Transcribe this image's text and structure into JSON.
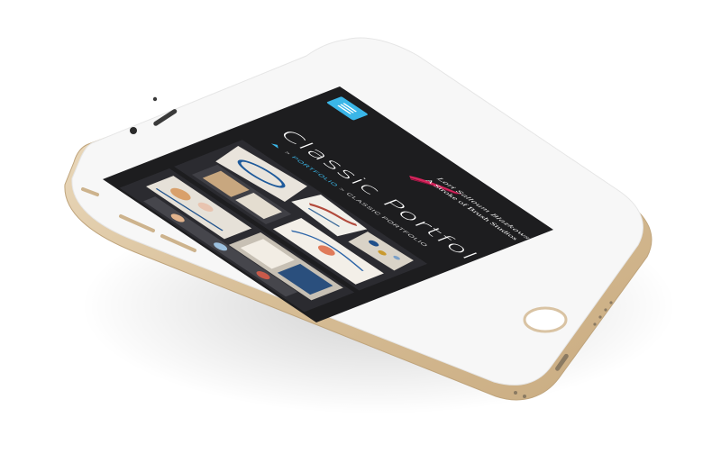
{
  "page": {
    "title": "Classic Portfolio",
    "breadcrumb": {
      "link": "PORTFOLIO",
      "separator": ">",
      "current": "CLASSIC PORTFOLIO"
    }
  },
  "logo": {
    "script_text": "Lori Salloum Blazkowski's",
    "main_text": "A Stroke of Brush Studios"
  },
  "icons": {
    "menu": "hamburger-menu-icon",
    "home": "home-icon"
  },
  "gallery": {
    "items": [
      {
        "alt": "portfolio-painted-artworks-1"
      },
      {
        "alt": "portfolio-painted-artworks-2"
      }
    ]
  },
  "colors": {
    "screen_bg": "#1d1d1f",
    "accent": "#3ab6e8",
    "logo_brush": "#d6245c",
    "phone_body": "#f7f7f7",
    "phone_frame": "#d9c3a3"
  }
}
